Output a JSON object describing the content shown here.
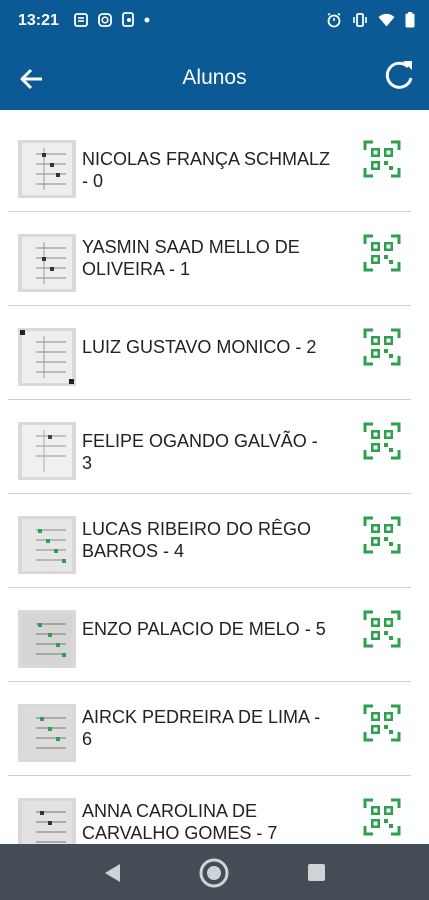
{
  "status": {
    "time": "13:21"
  },
  "header": {
    "title": "Alunos"
  },
  "students": [
    {
      "name": "NICOLAS FRANÇA SCHMALZ - 0"
    },
    {
      "name": "YASMIN SAAD MELLO DE OLIVEIRA - 1"
    },
    {
      "name": "LUIZ GUSTAVO MONICO - 2"
    },
    {
      "name": "FELIPE OGANDO GALVÃO - 3"
    },
    {
      "name": "LUCAS RIBEIRO DO RÊGO BARROS - 4"
    },
    {
      "name": "ENZO PALACIO DE MELO - 5"
    },
    {
      "name": "AIRCK PEDREIRA DE LIMA - 6"
    },
    {
      "name": "ANNA CAROLINA DE CARVALHO GOMES - 7"
    }
  ],
  "icons": {
    "back": "arrow-back-icon",
    "refresh": "refresh-icon",
    "qr": "qr-code-icon",
    "thumb": "answer-sheet-thumbnail",
    "nav_back": "nav-back-icon",
    "nav_home": "nav-home-icon",
    "nav_recents": "nav-recents-icon"
  },
  "colors": {
    "primary": "#0b5a96",
    "qr_green": "#2e9e4f",
    "navbar": "#444c55"
  }
}
